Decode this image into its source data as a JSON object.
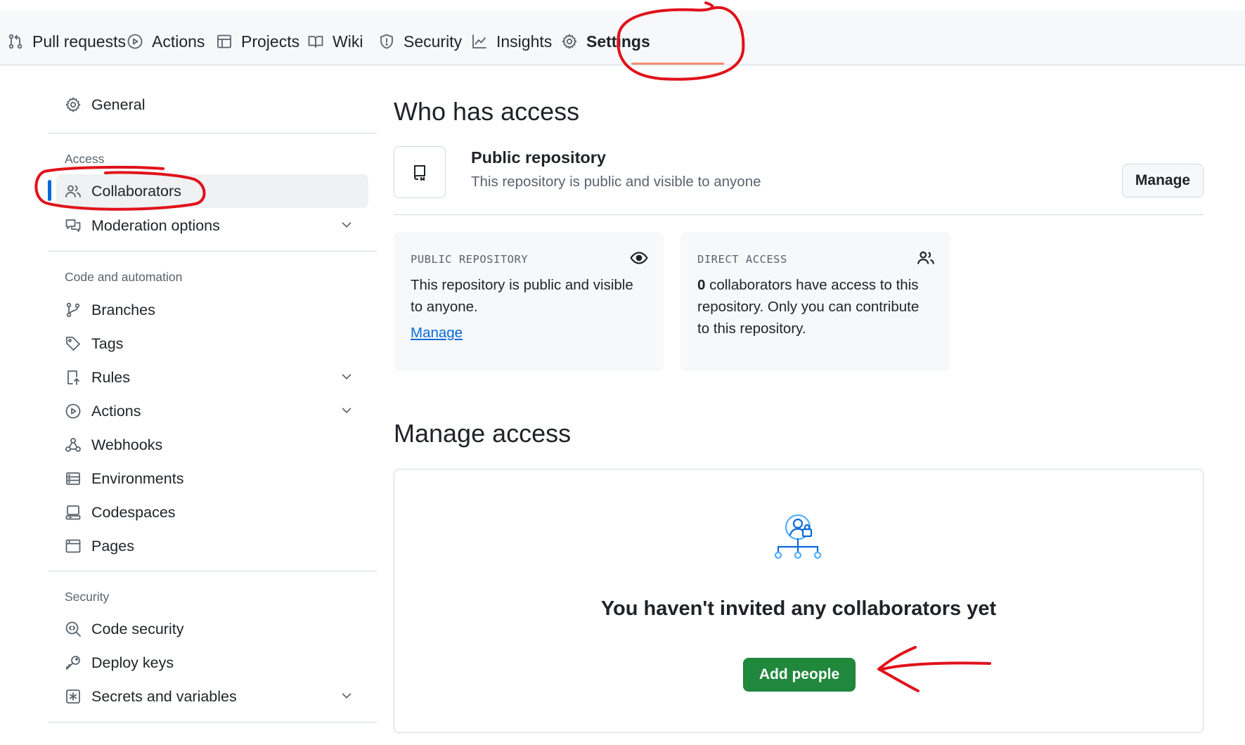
{
  "repo_tabs": [
    {
      "label": "Pull requests",
      "icon": "pull-request-icon"
    },
    {
      "label": "Actions",
      "icon": "play-icon"
    },
    {
      "label": "Projects",
      "icon": "table-icon"
    },
    {
      "label": "Wiki",
      "icon": "book-icon"
    },
    {
      "label": "Security",
      "icon": "shield-icon"
    },
    {
      "label": "Insights",
      "icon": "graph-icon"
    },
    {
      "label": "Settings",
      "icon": "gear-icon",
      "active": true
    }
  ],
  "sidebar": {
    "general": "General",
    "access_title": "Access",
    "collaborators": "Collaborators",
    "moderation": "Moderation options",
    "code_title": "Code and automation",
    "branches": "Branches",
    "tags": "Tags",
    "rules": "Rules",
    "actions": "Actions",
    "webhooks": "Webhooks",
    "environments": "Environments",
    "codespaces": "Codespaces",
    "pages": "Pages",
    "security_title": "Security",
    "code_security": "Code security",
    "deploy_keys": "Deploy keys",
    "secrets": "Secrets and variables"
  },
  "main": {
    "who_title": "Who has access",
    "public_title": "Public repository",
    "public_desc": "This repository is public and visible to anyone",
    "manage_button": "Manage",
    "card_public": {
      "label": "PUBLIC REPOSITORY",
      "body": "This repository is public and visible to anyone.",
      "link": "Manage"
    },
    "card_direct": {
      "label": "DIRECT ACCESS",
      "count": "0",
      "body": " collaborators have access to this repository. Only you can contribute to this repository."
    },
    "manage_title": "Manage access",
    "empty_title": "You haven't invited any collaborators yet",
    "add_button": "Add people"
  },
  "colors": {
    "accent_blue": "#0969da",
    "primary_green": "#1f883d",
    "active_underline": "#fd8c73",
    "annotation_red": "#e0121b"
  }
}
